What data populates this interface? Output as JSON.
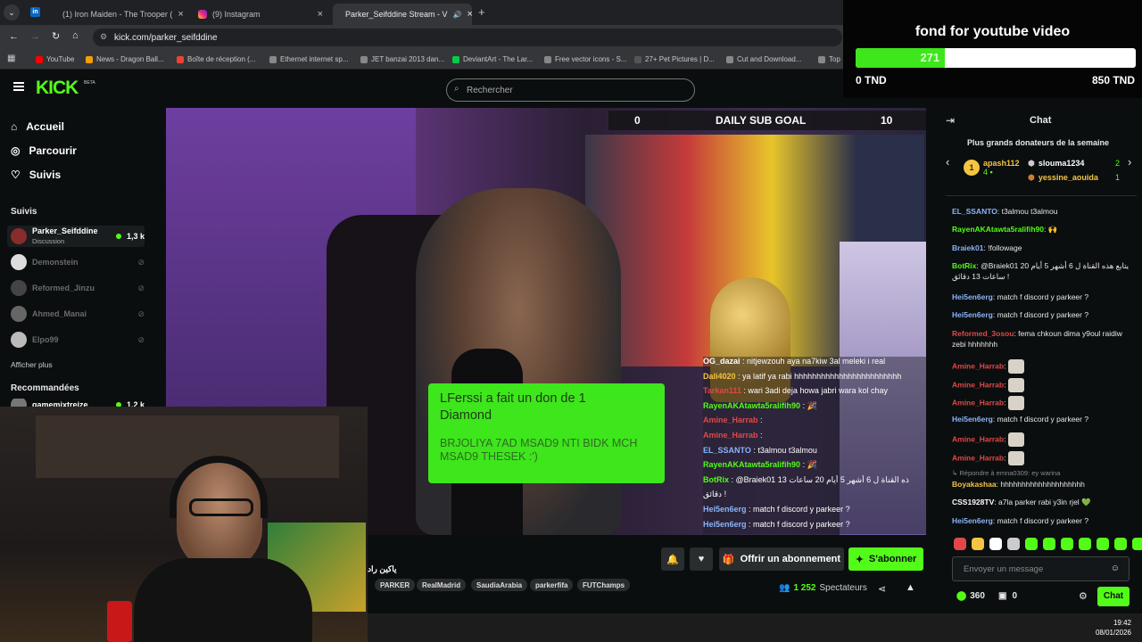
{
  "browser": {
    "tabs": [
      {
        "label": "(1) Iron Maiden - The Trooper (",
        "close": "×"
      },
      {
        "label": "(9) Instagram",
        "close": "×"
      },
      {
        "label": "Parker_Seifddine Stream - V",
        "close": "×"
      }
    ],
    "new_tab": "+",
    "url": "kick.com/parker_seifddine",
    "bookmarks": [
      "YouTube",
      "News - Dragon Ball...",
      "Boîte de réception (...",
      "Ethernet internet sp...",
      "JET banzai 2013 dan...",
      "DeviantArt - The Lar...",
      "Free vector icons - S...",
      "27+ Pet Pictures | D...",
      "Cut and Download...",
      "Top"
    ]
  },
  "kick": {
    "logo": "KICK",
    "beta": "BETA",
    "search_placeholder": "Rechercher",
    "nav": [
      "Accueil",
      "Parcourir",
      "Suivis"
    ],
    "following_title": "Suivis",
    "following": [
      {
        "name": "Parker_Seifddine",
        "sub": "Discussion",
        "viewers": "1,3 k",
        "live": true
      },
      {
        "name": "Demonstein",
        "live": false
      },
      {
        "name": "Reformed_Jinzu",
        "live": false
      },
      {
        "name": "Ahmed_Manai",
        "live": false
      },
      {
        "name": "Elpo99",
        "live": false
      }
    ],
    "show_more": "Afficher plus",
    "recommended_title": "Recommandées",
    "recommended": [
      {
        "name": "gamemixtreize",
        "viewers": "1,2 k"
      }
    ]
  },
  "video": {
    "goal": {
      "left": "0",
      "label": "DAILY SUB GOAL",
      "right": "10"
    },
    "donation": {
      "title": "LFerssi a fait un don de 1 Diamond",
      "message": "BRJOLIYA 7AD MSAD9 NTI BIDK MCH MSAD9 THESEK :')"
    },
    "overlay_chat": [
      {
        "user": "OG_dazai",
        "text": ": nitjewzouh aya na7kiw 3al meleki i real",
        "color": "#ffffff"
      },
      {
        "user": "Dali4020",
        "text": ": ya latif ya rabi hhhhhhhhhhhhhhhhhhhhhhhh",
        "color": "#f5c542"
      },
      {
        "user": "Tarkan111",
        "text": ": wari 3adi deja howa jabri wara kol chay",
        "color": "#e04848"
      },
      {
        "user": "RayenAKAtawta5ralifih90",
        "text": ": 🎉",
        "color": "#53fc18"
      },
      {
        "user": "Amine_Harrab",
        "text": ":",
        "color": "#e04848"
      },
      {
        "user": "Amine_Harrab",
        "text": ":",
        "color": "#e04848"
      },
      {
        "user": "EL_SSANTO",
        "text": ": t3almou t3almou",
        "color": "#8ab4f8"
      },
      {
        "user": "RayenAKAtawta5ralifih90",
        "text": ": 🎉",
        "color": "#53fc18"
      },
      {
        "user": "BotRix",
        "text": ": @Braiek01 ذه القناة ل 6 أشهر 5 أيام 20 ساعات 13",
        "color": "#53fc18"
      },
      {
        "user": "",
        "text": "دقائق !",
        "color": "#ffffff"
      },
      {
        "user": "Hei5en6erg",
        "text": ": match f discord y parkeer ?",
        "color": "#8ab4f8"
      },
      {
        "user": "Hei5en6erg",
        "text": ": match f discord y parkeer ?",
        "color": "#8ab4f8"
      }
    ]
  },
  "stream_info": {
    "title_fragment": "ياكين راد",
    "tags": [
      "PARKER",
      "RealMadrid",
      "SaudiaArabia",
      "parkerfifa",
      "FUTChamps"
    ],
    "offer_button": "Offrir un abonnement",
    "subscribe_button": "S'abonner",
    "viewers_count": "1 252",
    "viewers_label": "Spectateurs"
  },
  "chat": {
    "title": "Chat",
    "top_donors_title": "Plus grands donateurs de la semaine",
    "donors": [
      {
        "rank": "1",
        "name": "apash112",
        "amount": "4"
      },
      {
        "name": "slouma1234",
        "amount": "2"
      },
      {
        "name": "yessine_aouida",
        "amount": "1"
      }
    ],
    "messages": [
      {
        "user": "EL_SSANTO",
        "text": ": t3almou t3almou",
        "color": "#8ab4f8"
      },
      {
        "user": "RayenAKAtawta5ralifih90",
        "text": ": 🙌",
        "color": "#53fc18"
      },
      {
        "user": "Braiek01",
        "text": ": !followage",
        "color": "#8ab4f8"
      },
      {
        "user": "BotRix",
        "text": ": @Braiek01 يتابع هذه القناة ل 6 أشهر 5 أيام 20 ساعات 13 دقائق !",
        "color": "#53fc18"
      },
      {
        "user": "Hei5en6erg",
        "text": ": match f discord y parkeer ?",
        "color": "#8ab4f8"
      },
      {
        "user": "Hei5en6erg",
        "text": ": match f discord y parkeer ?",
        "color": "#8ab4f8"
      },
      {
        "user": "Reformed_3osou",
        "text": ": fema chkoun dima y9oul raidiw zebi hhhhhhh",
        "color": "#e04848"
      },
      {
        "user": "Amine_Harrab",
        "text": ":",
        "color": "#e04848"
      },
      {
        "user": "Amine_Harrab",
        "text": ":",
        "color": "#e04848"
      },
      {
        "user": "Amine_Harrab",
        "text": ":",
        "color": "#e04848"
      },
      {
        "user": "Hei5en6erg",
        "text": ": match f discord y parkeer ?",
        "color": "#8ab4f8"
      },
      {
        "user": "Amine_Harrab",
        "text": ":",
        "color": "#e04848"
      },
      {
        "user": "Amine_Harrab",
        "text": ":",
        "color": "#e04848"
      },
      {
        "user": "",
        "text": "↳ Répondre à emna0309: ey warina",
        "color": "#888888"
      },
      {
        "user": "Boyakashaa",
        "text": ": hhhhhhhhhhhhhhhhhhhh",
        "color": "#f5c542"
      },
      {
        "user": "CSS1928TV",
        "text": ": a7la parker rabi y3in rjel 💚",
        "color": "#ffffff"
      },
      {
        "user": "Hei5en6erg",
        "text": ": match f discord y parkeer ?",
        "color": "#8ab4f8"
      }
    ],
    "input_placeholder": "Envoyer un message",
    "points": "360",
    "gifts": "0",
    "send_button": "Chat"
  },
  "fund_overlay": {
    "title": "fond for youtube video",
    "current": "271",
    "min": "0 TND",
    "max": "850 TND",
    "progress_fraction": 0.319
  },
  "taskbar": {
    "time": "19:42",
    "date": "08/01/2026"
  }
}
